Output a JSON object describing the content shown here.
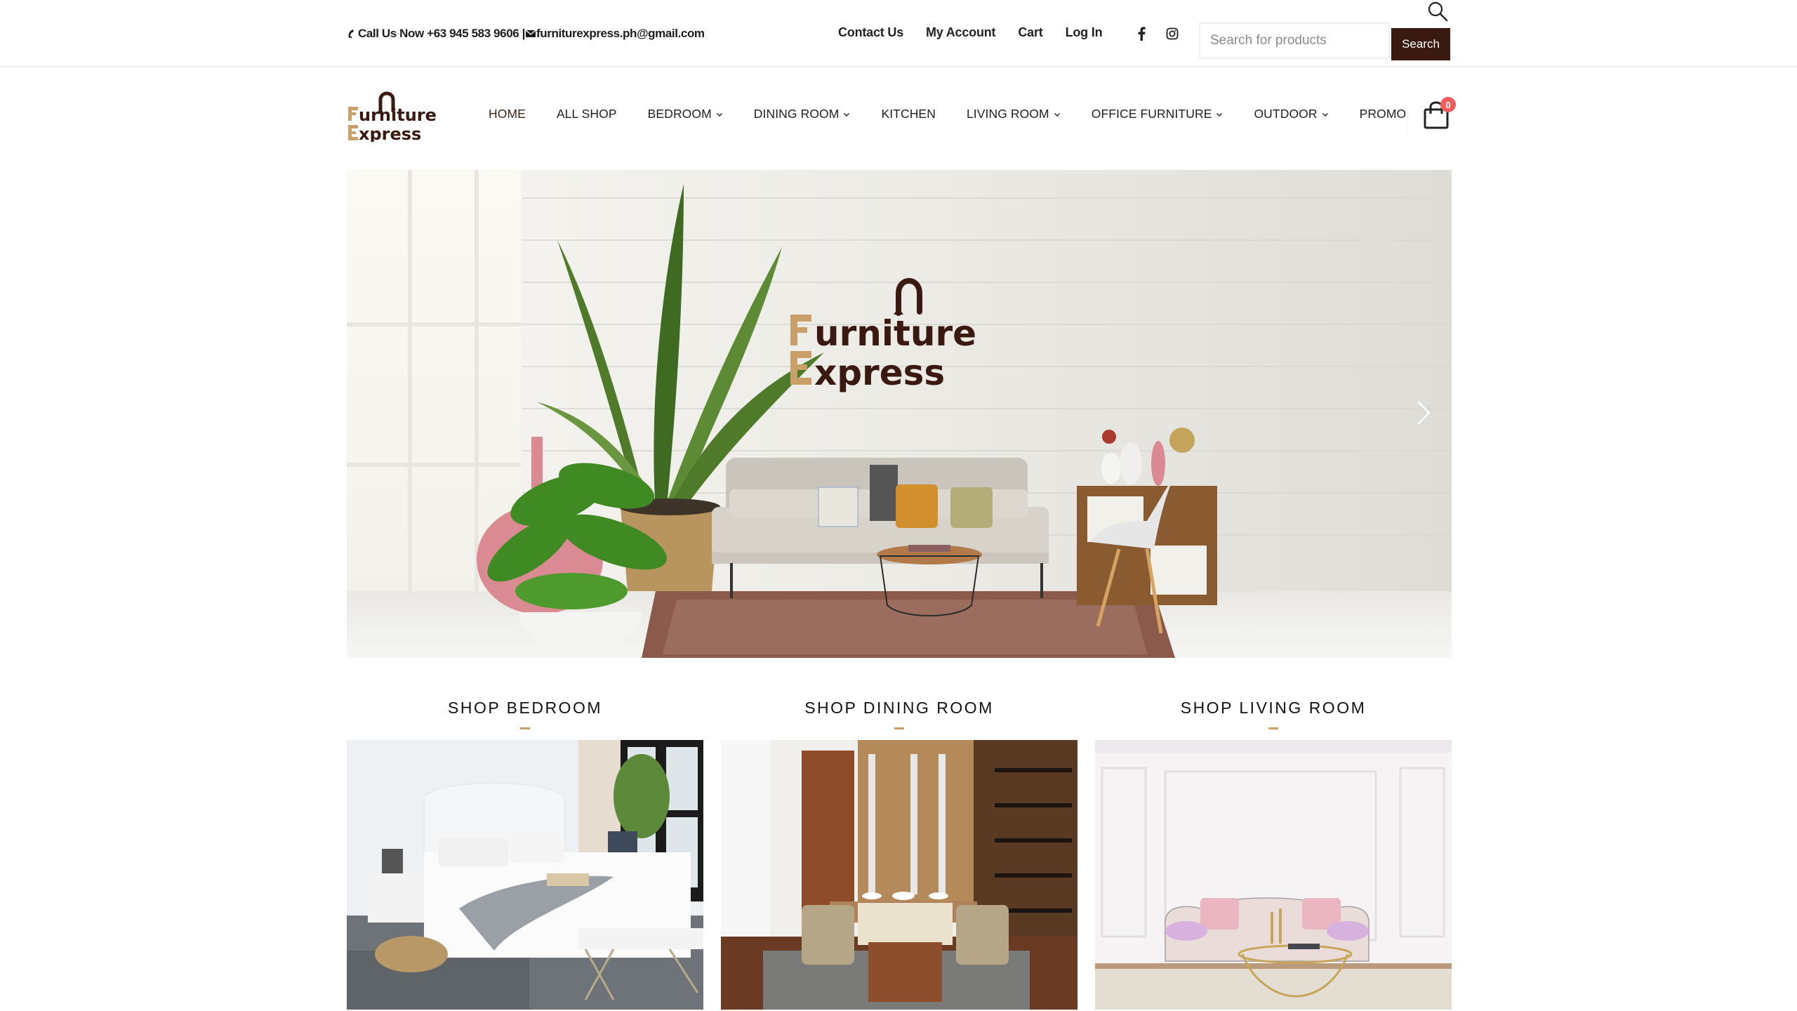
{
  "topbar": {
    "phone_icon": "phone-icon",
    "call_text": "Call Us Now +63 945 583 9606 |",
    "email_icon": "envelope-icon",
    "email": "furniturexpress.ph@gmail.com",
    "links": [
      {
        "label": "Contact Us"
      },
      {
        "label": "My Account"
      },
      {
        "label": "Cart"
      },
      {
        "label": "Log In"
      }
    ],
    "social": [
      {
        "icon": "facebook-icon"
      },
      {
        "icon": "instagram-icon"
      }
    ],
    "search": {
      "placeholder": "Search for products",
      "value": "",
      "button_label": "Search",
      "icon": "search-icon"
    }
  },
  "brand": {
    "name_line1": "Furniture",
    "name_line2": "Express",
    "accent_color": "#c9a06a",
    "primary_color": "#3a1a10"
  },
  "nav": {
    "items": [
      {
        "label": "HOME",
        "active": true,
        "dropdown": false
      },
      {
        "label": "ALL SHOP",
        "dropdown": false
      },
      {
        "label": "BEDROOM",
        "dropdown": true
      },
      {
        "label": "DINING ROOM",
        "dropdown": true
      },
      {
        "label": "KITCHEN",
        "dropdown": false
      },
      {
        "label": "LIVING ROOM",
        "dropdown": true
      },
      {
        "label": "OFFICE FURNITURE",
        "dropdown": true
      },
      {
        "label": "OUTDOOR",
        "dropdown": true
      },
      {
        "label": "PROMO",
        "dropdown": false
      }
    ],
    "cart": {
      "icon": "shopping-bag-icon",
      "count": "0",
      "badge_color": "#f25c5c"
    }
  },
  "hero": {
    "logo_line1": "Furniture",
    "logo_line2": "Express",
    "next_icon": "chevron-right-icon"
  },
  "categories": [
    {
      "title": "SHOP BEDROOM",
      "image": "bedroom-photo"
    },
    {
      "title": "SHOP DINING ROOM",
      "image": "dining-room-photo"
    },
    {
      "title": "SHOP LIVING ROOM",
      "image": "living-room-photo"
    }
  ]
}
